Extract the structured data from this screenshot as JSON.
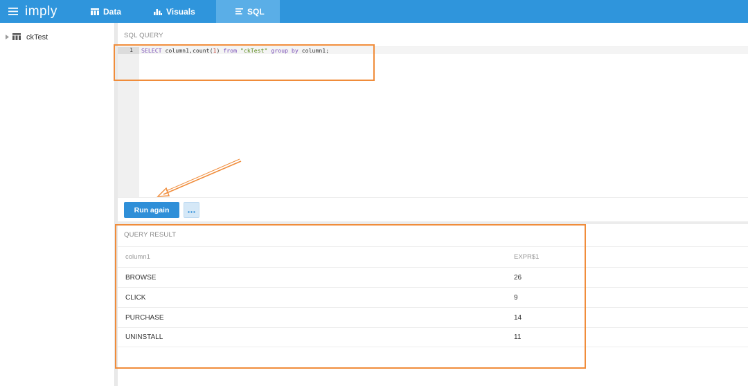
{
  "app": {
    "logo": "imply"
  },
  "nav": {
    "tabs": [
      {
        "label": "Data",
        "icon": "table-icon"
      },
      {
        "label": "Visuals",
        "icon": "bar-chart-icon"
      },
      {
        "label": "SQL",
        "icon": "sql-lines-icon",
        "active": true
      }
    ]
  },
  "sidebar": {
    "items": [
      {
        "label": "ckTest",
        "icon": "table-icon"
      }
    ]
  },
  "query": {
    "label": "SQL QUERY",
    "line_number": "1",
    "code": {
      "select": "SELECT",
      "part1": " column1,count(",
      "num": "1",
      "part2": ") ",
      "from": "from",
      "space": " ",
      "table": "\"ckTest\"",
      "space2": " ",
      "group_by": "group by",
      "part3": " column1;"
    }
  },
  "toolbar": {
    "run_label": "Run again",
    "more_label": "···"
  },
  "result": {
    "label": "QUERY RESULT",
    "columns": [
      "column1",
      "EXPR$1"
    ],
    "rows": [
      [
        "BROWSE",
        "26"
      ],
      [
        "CLICK",
        "9"
      ],
      [
        "PURCHASE",
        "14"
      ],
      [
        "UNINSTALL",
        "11"
      ]
    ]
  },
  "colors": {
    "topbar": "#2f95dc",
    "active_tab": "#5aaee7",
    "run_button": "#2f8fd8",
    "annotation": "#f08c3a"
  }
}
